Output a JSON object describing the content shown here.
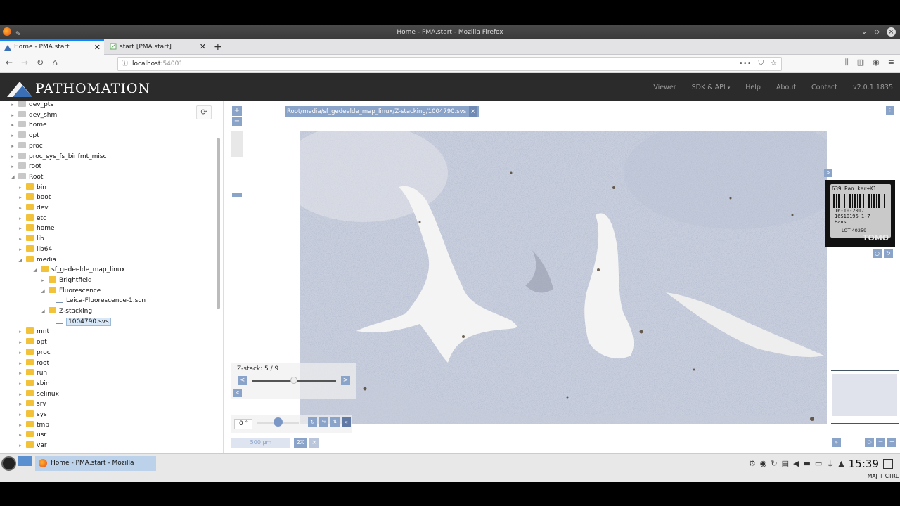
{
  "window": {
    "title": "Home - PMA.start - Mozilla Firefox"
  },
  "tabs": [
    {
      "label": "Home - PMA.start",
      "active": true
    },
    {
      "label": "start [PMA.start]",
      "active": false
    }
  ],
  "address": {
    "host": "localhost",
    "port": ":54001"
  },
  "app": {
    "brand": "PATHOMATION",
    "menu": [
      "Viewer",
      "SDK & API",
      "Help",
      "About",
      "Contact",
      "v2.0.1.1835"
    ]
  },
  "tree": [
    {
      "label": "dev_pts",
      "depth": 0,
      "icon": "grey",
      "arrow": "▸"
    },
    {
      "label": "dev_shm",
      "depth": 0,
      "icon": "grey",
      "arrow": "▸"
    },
    {
      "label": "home",
      "depth": 0,
      "icon": "grey",
      "arrow": "▸"
    },
    {
      "label": "opt",
      "depth": 0,
      "icon": "grey",
      "arrow": "▸"
    },
    {
      "label": "proc",
      "depth": 0,
      "icon": "grey",
      "arrow": "▸"
    },
    {
      "label": "proc_sys_fs_binfmt_misc",
      "depth": 0,
      "icon": "grey",
      "arrow": "▸"
    },
    {
      "label": "root",
      "depth": 0,
      "icon": "grey",
      "arrow": "▸"
    },
    {
      "label": "Root",
      "depth": 0,
      "icon": "grey",
      "arrow": "◢"
    },
    {
      "label": "bin",
      "depth": 1,
      "icon": "yellow",
      "arrow": "▸"
    },
    {
      "label": "boot",
      "depth": 1,
      "icon": "yellow",
      "arrow": "▸"
    },
    {
      "label": "dev",
      "depth": 1,
      "icon": "yellow",
      "arrow": "▸"
    },
    {
      "label": "etc",
      "depth": 1,
      "icon": "yellow",
      "arrow": "▸"
    },
    {
      "label": "home",
      "depth": 1,
      "icon": "yellow",
      "arrow": "▸"
    },
    {
      "label": "lib",
      "depth": 1,
      "icon": "yellow",
      "arrow": "▸"
    },
    {
      "label": "lib64",
      "depth": 1,
      "icon": "yellow",
      "arrow": "▸"
    },
    {
      "label": "media",
      "depth": 1,
      "icon": "yellow",
      "arrow": "◢"
    },
    {
      "label": "sf_gedeelde_map_linux",
      "depth": 2,
      "icon": "yellow",
      "arrow": "◢"
    },
    {
      "label": "Brightfield",
      "depth": 3,
      "icon": "yellow",
      "arrow": "▸"
    },
    {
      "label": "Fluorescence",
      "depth": 3,
      "icon": "yellow",
      "arrow": "◢"
    },
    {
      "label": "Leica-Fluorescence-1.scn",
      "depth": 4,
      "icon": "file",
      "arrow": ""
    },
    {
      "label": "Z-stacking",
      "depth": 3,
      "icon": "yellow",
      "arrow": "◢"
    },
    {
      "label": "1004790.svs",
      "depth": 4,
      "icon": "file",
      "arrow": "",
      "selected": true
    },
    {
      "label": "mnt",
      "depth": 1,
      "icon": "yellow",
      "arrow": "▸"
    },
    {
      "label": "opt",
      "depth": 1,
      "icon": "yellow",
      "arrow": "▸"
    },
    {
      "label": "proc",
      "depth": 1,
      "icon": "yellow",
      "arrow": "▸"
    },
    {
      "label": "root",
      "depth": 1,
      "icon": "yellow",
      "arrow": "▸"
    },
    {
      "label": "run",
      "depth": 1,
      "icon": "yellow",
      "arrow": "▸"
    },
    {
      "label": "sbin",
      "depth": 1,
      "icon": "yellow",
      "arrow": "▸"
    },
    {
      "label": "selinux",
      "depth": 1,
      "icon": "yellow",
      "arrow": "▸"
    },
    {
      "label": "srv",
      "depth": 1,
      "icon": "yellow",
      "arrow": "▸"
    },
    {
      "label": "sys",
      "depth": 1,
      "icon": "yellow",
      "arrow": "▸"
    },
    {
      "label": "tmp",
      "depth": 1,
      "icon": "yellow",
      "arrow": "▸"
    },
    {
      "label": "usr",
      "depth": 1,
      "icon": "yellow",
      "arrow": "▸"
    },
    {
      "label": "var",
      "depth": 1,
      "icon": "yellow",
      "arrow": "▸"
    }
  ],
  "viewer": {
    "path": "Root/media/sf_gedeelde_map_linux/Z-stacking/1004790.svs",
    "path_close": "×",
    "zoom_in": "+",
    "zoom_out": "−",
    "zstack_label": "Z-stack: 5 / 9",
    "zstack_value": 5,
    "zstack_total": 9,
    "zstack_prev": "<",
    "zstack_next": ">",
    "collapse": "«",
    "rotation_value": "0",
    "rotation_unit": "°",
    "scale_label": "500 µm",
    "scale_zoom": "2X",
    "scale_close": "×",
    "expand_label": "»",
    "label_text_lines": [
      "639 Pan ker+K1",
      "16-10-2017",
      "16S10196 1-7",
      "Hans",
      "LOT 40259",
      "TOMO"
    ]
  },
  "taskbar": {
    "task_label": "Home - PMA.start - Mozilla Firefox",
    "clock": "15:39",
    "kbd": "MAJ + CTRL"
  }
}
